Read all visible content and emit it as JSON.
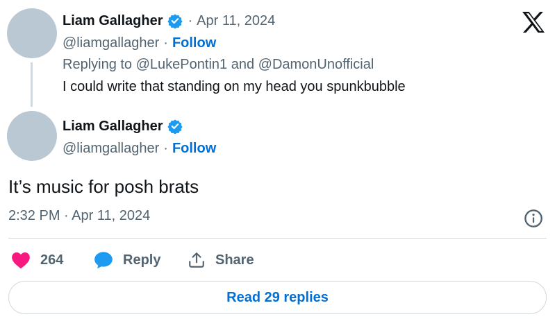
{
  "parent_tweet": {
    "author_name": "Liam Gallagher",
    "dot": "·",
    "date": "Apr 11, 2024",
    "handle": "@liamgallagher",
    "follow_label": "Follow",
    "replying_prefix": "Replying to",
    "replying_user_1": "@LukePontin1",
    "replying_and": "and",
    "replying_user_2": "@DamonUnofficial",
    "text": "I could write that standing on my head you spunkbubble"
  },
  "main_tweet": {
    "author_name": "Liam Gallagher",
    "handle": "@liamgallagher",
    "dot": "·",
    "follow_label": "Follow",
    "text": "It’s music for posh brats",
    "timestamp": "2:32 PM · Apr 11, 2024"
  },
  "actions": {
    "like_count": "264",
    "reply_label": "Reply",
    "share_label": "Share"
  },
  "read_replies_label": "Read 29 replies",
  "colors": {
    "accent_blue": "#006fd6",
    "verified_blue": "#1d9bf0",
    "like_pink": "#f91880",
    "muted_gray": "#536471"
  },
  "icons": [
    "verified-badge-icon",
    "x-logo-icon",
    "info-icon",
    "heart-icon",
    "reply-bubble-icon",
    "share-icon"
  ]
}
